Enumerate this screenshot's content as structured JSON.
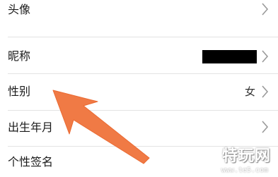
{
  "settings": {
    "rows": [
      {
        "label": "头像",
        "value": ""
      },
      {
        "label": "昵称",
        "value": ""
      },
      {
        "label": "性别",
        "value": "女"
      },
      {
        "label": "出生年月",
        "value": ""
      },
      {
        "label": "个性签名",
        "value": ""
      }
    ]
  },
  "annotation": {
    "arrow_color": "#f07a45",
    "arrow_points_to": "性别"
  },
  "watermark": {
    "title": "特玩网",
    "url": "www.te5.com"
  },
  "icons": {
    "chevron": "chevron-right-icon"
  }
}
